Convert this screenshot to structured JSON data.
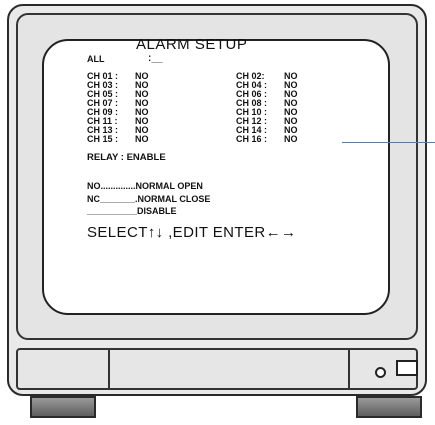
{
  "osd": {
    "title": "ALARM SETUP",
    "all_label": "ALL",
    "all_value": ":__",
    "channels_left": [
      {
        "label": "CH 01 :",
        "value": "NO"
      },
      {
        "label": "CH 03 :",
        "value": "NO"
      },
      {
        "label": "CH 05 :",
        "value": "NO"
      },
      {
        "label": "CH 07 :",
        "value": "NO"
      },
      {
        "label": "CH 09 :",
        "value": "NO"
      },
      {
        "label": "CH 11 :",
        "value": "NO"
      },
      {
        "label": "CH 13 :",
        "value": "NO"
      },
      {
        "label": "CH 15 :",
        "value": "NO"
      }
    ],
    "channels_right": [
      {
        "label": "CH 02:",
        "value": "NO"
      },
      {
        "label": "CH 04 :",
        "value": "NO"
      },
      {
        "label": "CH 06 :",
        "value": "NO"
      },
      {
        "label": "CH 08 :",
        "value": "NO"
      },
      {
        "label": "CH 10 :",
        "value": "NO"
      },
      {
        "label": "CH 12 :",
        "value": "NO"
      },
      {
        "label": "CH 14 :",
        "value": "NO"
      },
      {
        "label": "CH 16 :",
        "value": "NO"
      }
    ],
    "relay": "RELAY : ENABLE",
    "legend": [
      "NO..............NORMAL OPEN",
      "NC_______.NORMAL CLOSE",
      "__________DISABLE"
    ],
    "footer": "SELECT↑↓ ,EDIT ENTER←→"
  }
}
